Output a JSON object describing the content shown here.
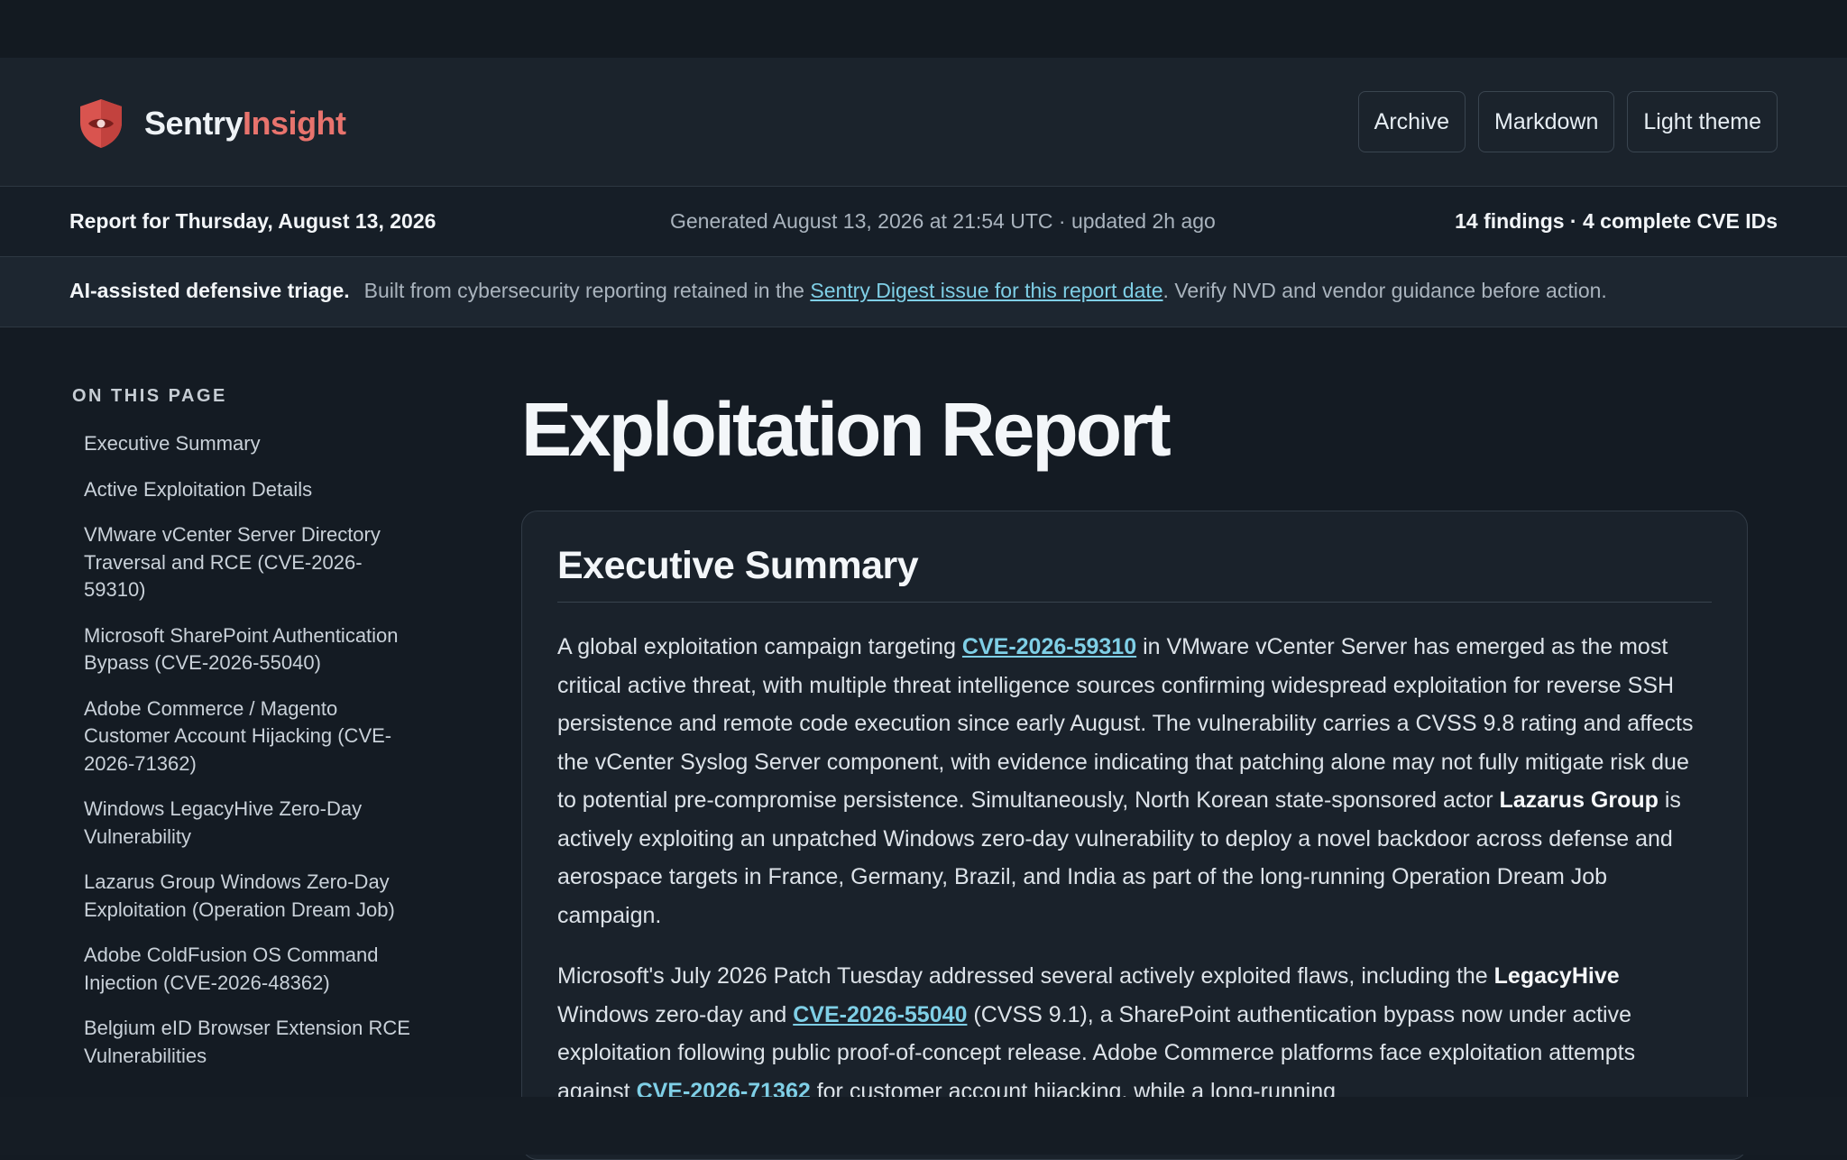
{
  "brand": {
    "name_part1": "Sentry",
    "name_part2": "Insight",
    "accent": "#e8736d",
    "icon": "shield-eye-icon"
  },
  "header": {
    "buttons": [
      {
        "label": "Archive"
      },
      {
        "label": "Markdown"
      },
      {
        "label": "Light theme"
      }
    ]
  },
  "meta": {
    "report_for": "Report for Thursday, August 13, 2026",
    "generated": "Generated August 13, 2026 at 21:54 UTC · updated 2h ago",
    "counts": "14 findings · 4 complete CVE IDs"
  },
  "notice": {
    "strong": "AI-assisted defensive triage.",
    "text_before": "Built from cybersecurity reporting retained in the ",
    "link": "Sentry Digest issue for this report date",
    "text_after": ". Verify NVD and vendor guidance before action."
  },
  "toc": {
    "heading": "ON THIS PAGE",
    "items": [
      {
        "label": "Executive Summary"
      },
      {
        "label": "Active Exploitation Details"
      },
      {
        "label": "VMware vCenter Server Directory Traversal and RCE (CVE-2026-59310)"
      },
      {
        "label": "Microsoft SharePoint Authentication Bypass (CVE-2026-55040)"
      },
      {
        "label": "Adobe Commerce / Magento Customer Account Hijacking (CVE-2026-71362)"
      },
      {
        "label": "Windows LegacyHive Zero-Day Vulnerability"
      },
      {
        "label": "Lazarus Group Windows Zero-Day Exploitation (Operation Dream Job)"
      },
      {
        "label": "Adobe ColdFusion OS Command Injection (CVE-2026-48362)"
      },
      {
        "label": "Belgium eID Browser Extension RCE Vulnerabilities"
      }
    ]
  },
  "main": {
    "title": "Exploitation Report",
    "section_title": "Executive Summary",
    "p1": {
      "t1": "A global exploitation campaign targeting ",
      "cve1": "CVE-2026-59310",
      "t2": " in VMware vCenter Server has emerged as the most critical active threat, with multiple threat intelligence sources confirming widespread exploitation for reverse SSH persistence and remote code execution since early August. The vulnerability carries a CVSS 9.8 rating and affects the vCenter Syslog Server component, with evidence indicating that patching alone may not fully mitigate risk due to potential pre-compromise persistence. Simultaneously, North Korean state-sponsored actor ",
      "b1": "Lazarus Group",
      "t3": " is actively exploiting an unpatched Windows zero-day vulnerability to deploy a novel backdoor across defense and aerospace targets in France, Germany, Brazil, and India as part of the long-running Operation Dream Job campaign."
    },
    "p2": {
      "t1": "Microsoft's July 2026 Patch Tuesday addressed several actively exploited flaws, including the ",
      "b1": "LegacyHive",
      "t2": " Windows zero-day and ",
      "cve2": "CVE-2026-55040",
      "t3": " (CVSS 9.1), a SharePoint authentication bypass now under active exploitation following public proof-of-concept release. Adobe Commerce platforms face exploitation attempts against ",
      "cve3": "CVE-2026-71362",
      "t4": " for customer account hijacking, while a long-running"
    }
  }
}
